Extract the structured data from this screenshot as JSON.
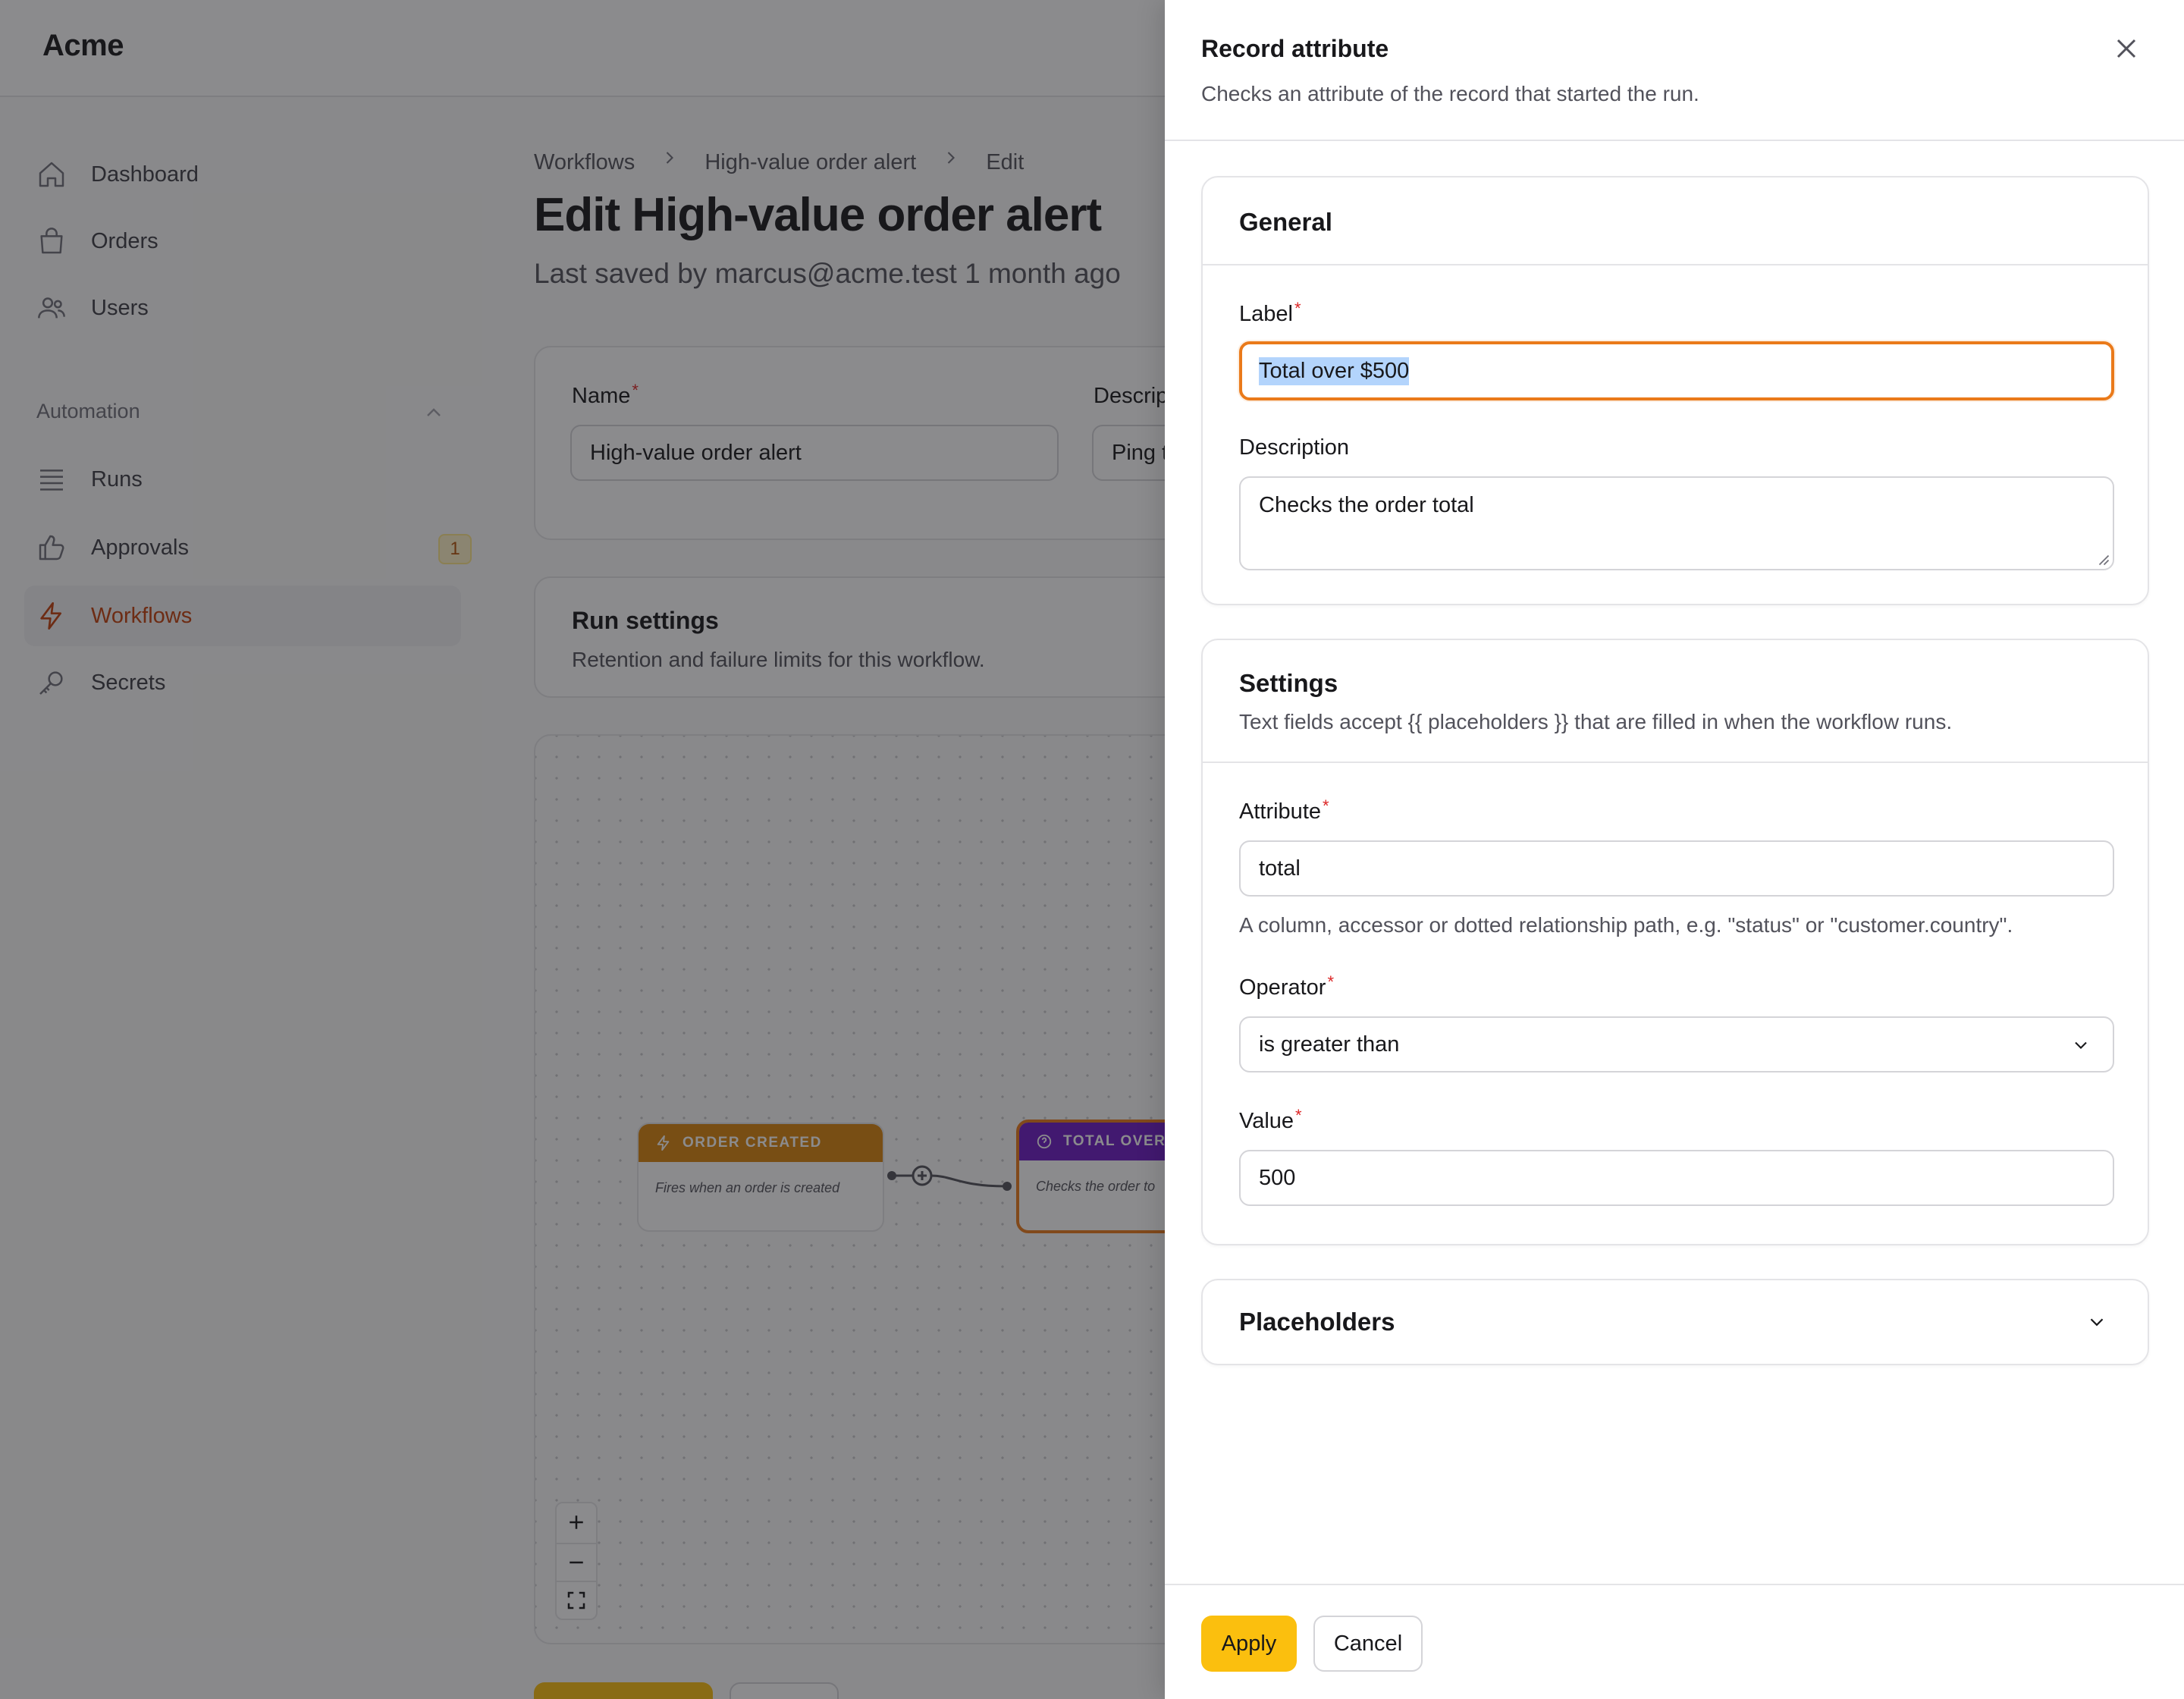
{
  "app": {
    "brand": "Acme"
  },
  "sidebar": {
    "items": [
      {
        "label": "Dashboard",
        "icon": "home-icon"
      },
      {
        "label": "Orders",
        "icon": "shopping-bag-icon"
      },
      {
        "label": "Users",
        "icon": "users-icon"
      }
    ],
    "group_label": "Automation",
    "group_items": [
      {
        "label": "Runs",
        "icon": "list-icon"
      },
      {
        "label": "Approvals",
        "icon": "thumbs-up-icon",
        "badge": "1"
      },
      {
        "label": "Workflows",
        "icon": "bolt-icon",
        "active": true
      },
      {
        "label": "Secrets",
        "icon": "key-icon"
      }
    ]
  },
  "breadcrumb": [
    "Workflows",
    "High-value order alert",
    "Edit"
  ],
  "page": {
    "title": "Edit High-value order alert",
    "subtitle": "Last saved by marcus@acme.test 1 month ago"
  },
  "form": {
    "name_label": "Name",
    "name_value": "High-value order alert",
    "description_label": "Descrip",
    "description_value": "Ping t"
  },
  "run_settings": {
    "title": "Run settings",
    "description": "Retention and failure limits for this workflow."
  },
  "canvas": {
    "nodes": [
      {
        "title": "ORDER CREATED",
        "description": "Fires when an order is created",
        "color": "#d9850c"
      },
      {
        "title": "TOTAL OVER $",
        "description": "Checks the order to",
        "color": "#6d1bc4"
      }
    ]
  },
  "panel": {
    "title": "Record attribute",
    "subtitle": "Checks an attribute of the record that started the run.",
    "general": {
      "title": "General",
      "label_label": "Label",
      "label_value": "Total over $500",
      "description_label": "Description",
      "description_value": "Checks the order total"
    },
    "settings": {
      "title": "Settings",
      "description": "Text fields accept {{ placeholders }} that are filled in when the workflow runs.",
      "attribute_label": "Attribute",
      "attribute_value": "total",
      "attribute_hint": "A column, accessor or dotted relationship path, e.g. \"status\" or \"customer.country\".",
      "operator_label": "Operator",
      "operator_value": "is greater than",
      "value_label": "Value",
      "value_value": "500"
    },
    "placeholders": {
      "title": "Placeholders"
    },
    "footer": {
      "apply_label": "Apply",
      "cancel_label": "Cancel"
    }
  },
  "colors": {
    "accent": "#c2410c",
    "focus_ring": "#ea7a1a",
    "apply_button": "#fbbf0e",
    "required": "#dc2626",
    "overlay": "rgba(24,24,27,0.5)"
  }
}
